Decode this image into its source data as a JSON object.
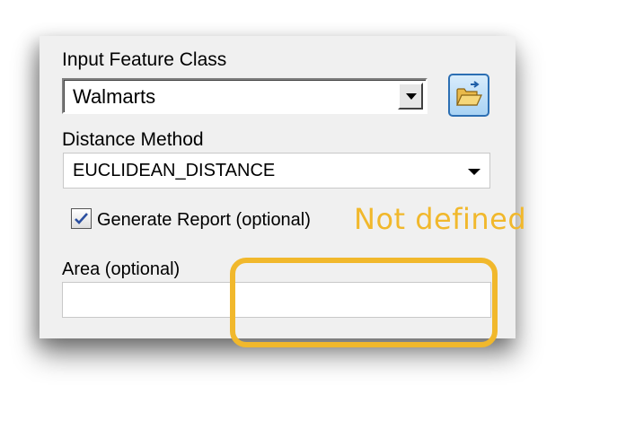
{
  "fields": {
    "input_feature_class": {
      "label": "Input Feature Class",
      "value": "Walmarts",
      "browse_icon": "open-folder-icon"
    },
    "distance_method": {
      "label": "Distance Method",
      "value": "EUCLIDEAN_DISTANCE"
    },
    "generate_report": {
      "label": "Generate Report (optional)",
      "checked": true
    },
    "area": {
      "label": "Area (optional)",
      "value": ""
    }
  },
  "annotation": {
    "text": "Not defined",
    "color": "#f1b82c"
  }
}
